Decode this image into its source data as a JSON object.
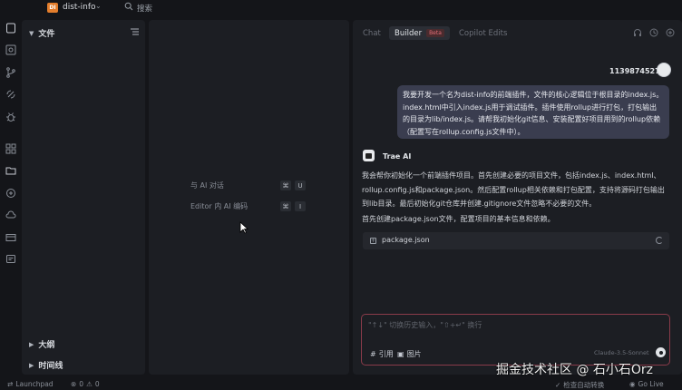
{
  "titlebar": {
    "project_badge": "DI",
    "project_name": "dist-info",
    "search_label": "搜索"
  },
  "activity": {
    "icons": [
      "explorer-icon",
      "search-icon",
      "source-control-icon",
      "run-debug-icon",
      "bug-icon",
      "extensions-icon",
      "folder-icon",
      "remote-icon",
      "cloud-icon",
      "mail-icon",
      "comment-icon"
    ]
  },
  "sidebar": {
    "files_label": "文件",
    "outline_label": "大纲",
    "timeline_label": "时间线"
  },
  "editor": {
    "hint_chat": "与 AI 对话",
    "hint_chat_key": "U",
    "hint_edit": "Editor 内 AI 编码",
    "hint_edit_key": "I",
    "modifier_key": "⌘"
  },
  "panel": {
    "tabs": [
      "Chat",
      "Builder",
      "Copilot Edits"
    ],
    "active_tab": "Builder",
    "beta_badge": "Beta",
    "user_name": "1139874527",
    "user_message": "我要开发一个名为dist-info的前端插件，文件的核心逻辑位于根目录的index.js。index.html中引入index.js用于调试插件。插件使用rollup进行打包，打包输出的目录为lib/index.js。请帮我初始化git信息、安装配置好项目用到的rollup依赖（配置写在rollup.config.js文件中）。",
    "ai_name": "Trae AI",
    "ai_message": "我会帮你初始化一个前端插件项目。首先创建必要的项目文件，包括index.js、index.html、rollup.config.js和package.json。然后配置rollup相关依赖和打包配置，支持将源码打包输出到lib目录。最后初始化git仓库并创建.gitignore文件忽略不必要的文件。",
    "ai_step": "首先创建package.json文件，配置项目的基本信息和依赖。",
    "file_card": "package.json",
    "input_placeholder": "\"↑↓\" 切换历史输入，\"⇧+↵\" 换行",
    "ref_label": "引用",
    "image_label": "图片",
    "model_label": "Claude-3.5-Sonnet"
  },
  "watermark": "掘金技术社区 @ 石小石Orz",
  "statusbar": {
    "launchpad": "Launchpad",
    "errors": "0",
    "warnings": "0",
    "auto_wrap": "检查自动转换",
    "go_live": "Go Live"
  },
  "colors": {
    "accent": "#e37d2c",
    "user_bubble": "#3a3d4f",
    "input_border": "#8a3b4a"
  }
}
